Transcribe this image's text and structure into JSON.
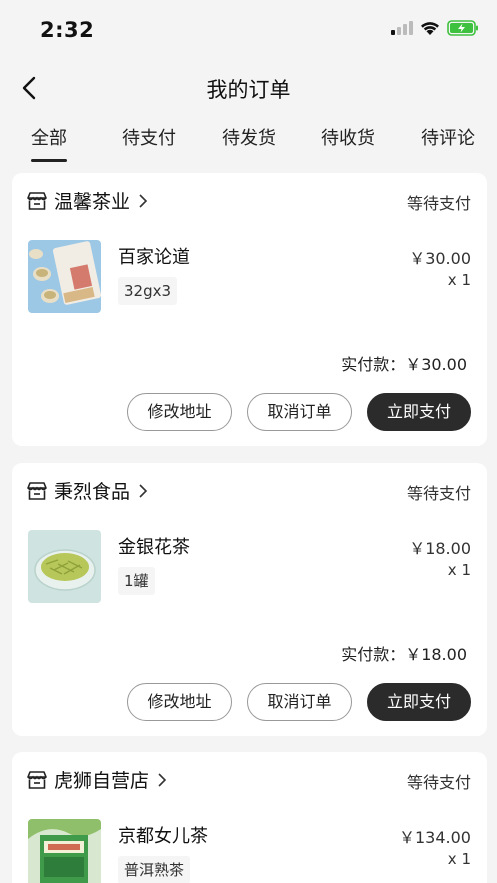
{
  "status_bar": {
    "time": "2:32"
  },
  "nav": {
    "title": "我的订单"
  },
  "tabs": [
    {
      "label": "全部",
      "active": true
    },
    {
      "label": "待支付"
    },
    {
      "label": "待发货"
    },
    {
      "label": "待收货"
    },
    {
      "label": "待评论"
    }
  ],
  "orders": [
    {
      "shop": "温馨茶业",
      "status": "等待支付",
      "product": "百家论道",
      "spec": "32gx3",
      "price": "￥30.00",
      "qty": "x 1",
      "paid": "实付款：￥30.00",
      "buttons": {
        "modify": "修改地址",
        "cancel": "取消订单",
        "pay": "立即支付"
      }
    },
    {
      "shop": "秉烈食品",
      "status": "等待支付",
      "product": "金银花茶",
      "spec": "1罐",
      "price": "￥18.00",
      "qty": "x 1",
      "paid": "实付款：￥18.00",
      "buttons": {
        "modify": "修改地址",
        "cancel": "取消订单",
        "pay": "立即支付"
      }
    },
    {
      "shop": "虎狮自营店",
      "status": "等待支付",
      "product": "京都女儿茶",
      "spec": "普洱熟茶",
      "price": "￥134.00",
      "qty": "x 1"
    }
  ],
  "icons": {
    "back": "chevron-left-icon",
    "shop": "store-icon",
    "chevron": "chevron-right-icon",
    "signal": "cellular-signal-icon",
    "wifi": "wifi-icon",
    "battery": "battery-charging-icon"
  },
  "colors": {
    "primary_button": "#2b2b2b",
    "background": "#f4f4f4",
    "battery": "#3ec13e"
  }
}
